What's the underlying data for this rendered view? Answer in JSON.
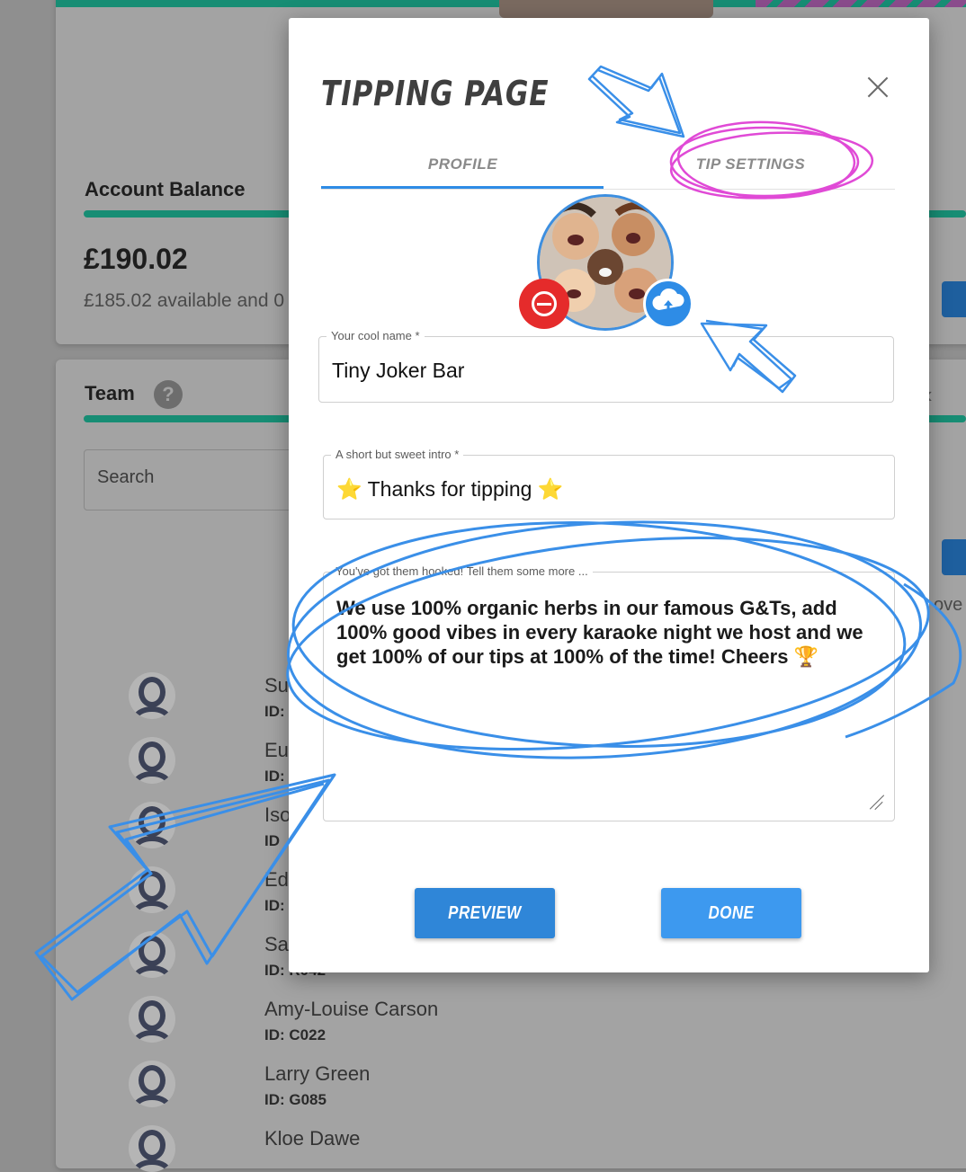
{
  "background": {
    "account": {
      "title": "Account Balance",
      "amount": "£190.02",
      "available": "£185.02 available and 0"
    },
    "team": {
      "title": "Team",
      "help_icon": "question-mark-icon",
      "search_label": "Search",
      "right_text": "ove",
      "members": [
        {
          "name": "Su",
          "id": "ID:"
        },
        {
          "name": "Eu",
          "id": "ID:"
        },
        {
          "name": "Iso",
          "id": "ID"
        },
        {
          "name": "Ed",
          "id": "ID:"
        },
        {
          "name": "Sa",
          "id": "ID: R042"
        },
        {
          "name": "Amy-Louise Carson",
          "id": "ID: C022"
        },
        {
          "name": "Larry Green",
          "id": "ID: G085"
        },
        {
          "name": "Kloe Dawe",
          "id": ""
        }
      ]
    }
  },
  "modal": {
    "title": "TIPPING PAGE",
    "close_icon": "close-icon",
    "tabs": [
      {
        "label": "PROFILE",
        "active": true
      },
      {
        "label": "TIP SETTINGS",
        "active": false
      }
    ],
    "fields": {
      "name_label": "Your cool name *",
      "name_value": "Tiny Joker Bar",
      "intro_label": "A short but sweet intro *",
      "intro_value": "⭐ Thanks for tipping ⭐",
      "more_label": "You've got them hooked! Tell them some more ...",
      "more_value": "We use 100% organic herbs in our famous G&Ts, add 100% good vibes in every karaoke night we host and we get 100% of our tips at 100% of the time! Cheers 🏆"
    },
    "buttons": {
      "preview": "PREVIEW",
      "done": "DONE"
    },
    "icons": {
      "remove": "remove-photo-icon",
      "upload": "upload-cloud-icon"
    }
  },
  "colors": {
    "accent_blue": "#2e8ce6",
    "remove_red": "#e52b2b",
    "brand_green": "#178d74",
    "annotation_blue": "#3a8fe8",
    "annotation_pink": "#e04ad6"
  }
}
